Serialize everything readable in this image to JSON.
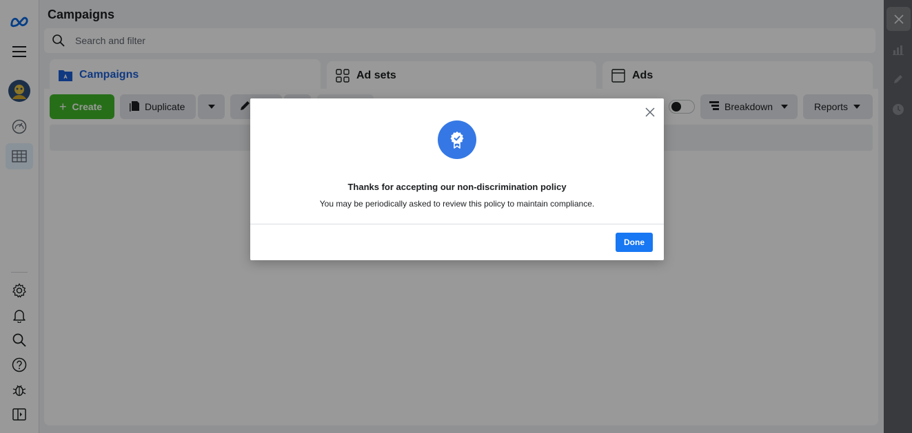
{
  "app": {
    "logo_icon": "meta-logo-icon"
  },
  "leftnav": {
    "icons": [
      "menu-icon",
      "avatar",
      "dashboard-gauge-icon",
      "ads-manager-table-icon",
      "settings-gear-icon",
      "notifications-bell-icon",
      "search-icon",
      "help-icon",
      "bug-icon",
      "collapse-panel-icon"
    ]
  },
  "header": {
    "title": "Campaigns",
    "search_placeholder": "Search and filter"
  },
  "tabs": [
    {
      "label": "Campaigns",
      "active": true
    },
    {
      "label": "Ad sets",
      "active": false
    },
    {
      "label": "Ads",
      "active": false
    }
  ],
  "toolbar": {
    "create_label": "Create",
    "duplicate_label": "Duplicate",
    "breakdown_label": "Breakdown",
    "reports_label": "Reports"
  },
  "rightrail": {
    "icons": [
      "close-icon",
      "bar-chart-icon",
      "edit-pencil-icon",
      "history-clock-icon"
    ]
  },
  "modal": {
    "icon": "verified-badge-icon",
    "title": "Thanks for accepting our non-discrimination policy",
    "body": "You may be periodically asked to review this policy to maintain compliance.",
    "done_label": "Done"
  },
  "colors": {
    "accent": "#1877f2",
    "create_green": "#42b72a",
    "badge_blue": "#3578e5",
    "active_tab_text": "#1c5fd8"
  }
}
